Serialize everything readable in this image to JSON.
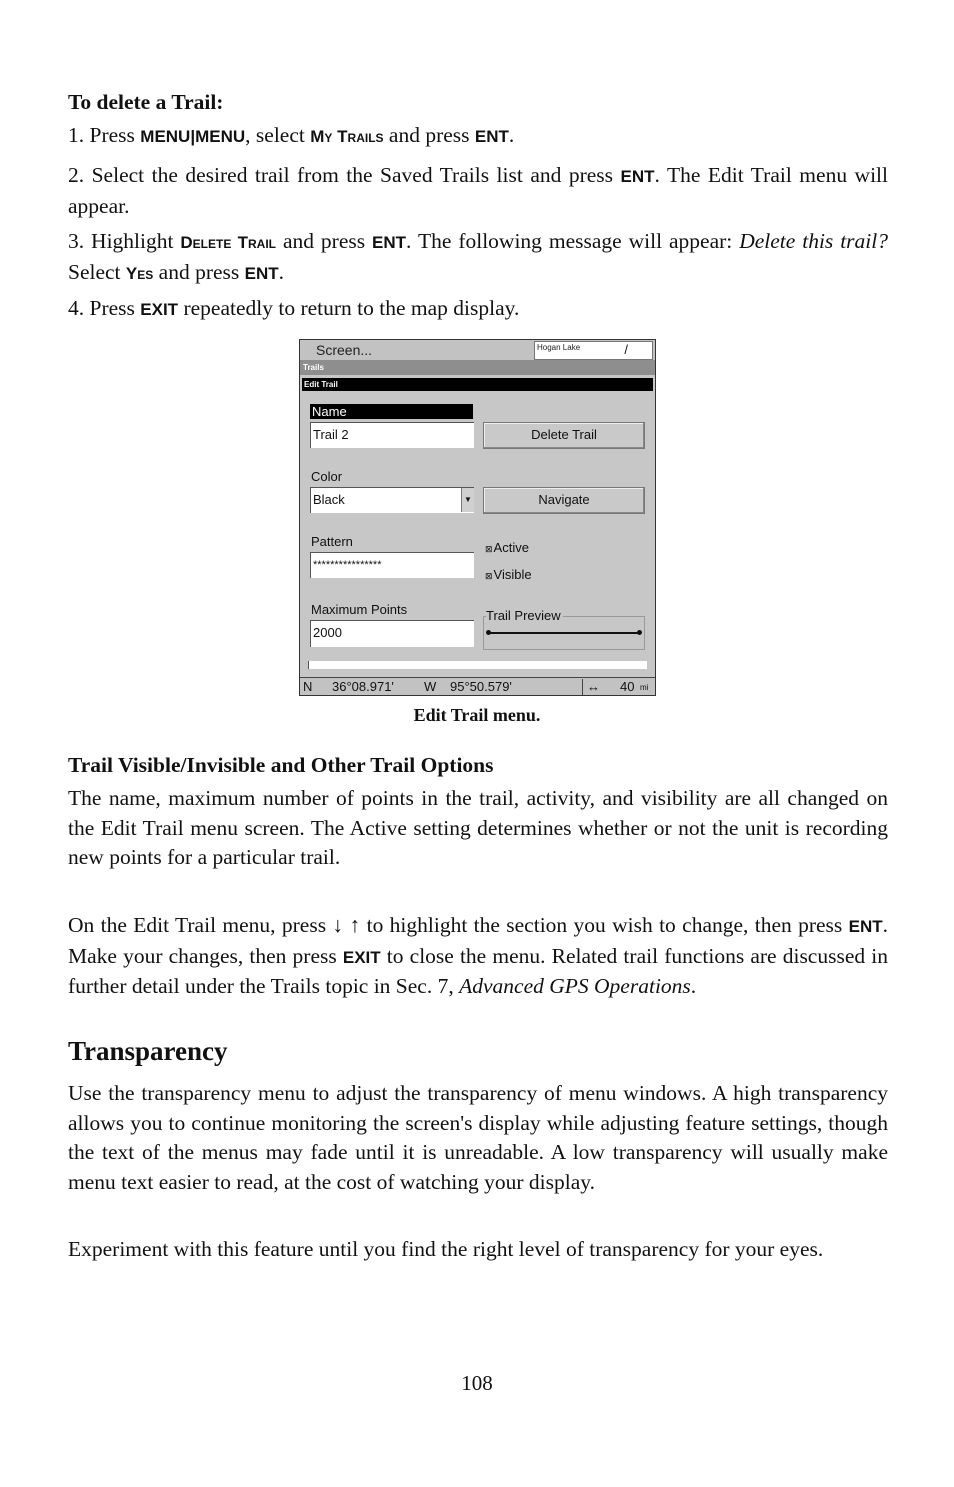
{
  "delete_trail": {
    "heading": "To delete a Trail:",
    "step1": {
      "pre": "1. Press ",
      "key1": "MENU",
      "sep": "|",
      "key2": "MENU",
      "mid": ", select ",
      "menu": "My Trails",
      "mid2": " and press ",
      "key3": "ENT",
      "end": "."
    },
    "step2": {
      "pre": "2. Select the desired trail from the Saved Trails list and press ",
      "key": "ENT",
      "end": ". The Edit Trail menu will appear."
    },
    "step3": {
      "pre": "3. Highlight ",
      "menu": "Delete Trail",
      "mid": " and press ",
      "key1": "ENT",
      "mid2": ". The following message will appear: ",
      "italic": "Delete this trail?",
      "mid3": " Select ",
      "menu2": "Yes",
      "mid4": " and press ",
      "key2": "ENT",
      "end": "."
    },
    "step4": {
      "pre": "4. Press ",
      "key": "EXIT",
      "end": " repeatedly to return to the map display."
    }
  },
  "screen": {
    "top_label": "Screen...",
    "map_label": "Hogan Lake",
    "trails_bar": "Trails",
    "edit_bar": "Edit Trail",
    "name_label": "Name",
    "name_value": "Trail 2",
    "delete_button": "Delete Trail",
    "color_label": "Color",
    "color_value": "Black",
    "navigate_button": "Navigate",
    "pattern_label": "Pattern",
    "pattern_value": "****************",
    "active_label": "Active",
    "active_checked": true,
    "visible_label": "Visible",
    "visible_checked": true,
    "max_points_label": "Maximum Points",
    "max_points_value": "2000",
    "preview_label": "Trail Preview",
    "status": {
      "lat_hem": "N",
      "lat": "36°08.971'",
      "lon_hem": "W",
      "lon": "95°50.579'",
      "zoom_icon": "↔",
      "zoom": "40",
      "unit": "mi"
    }
  },
  "caption": "Edit Trail menu.",
  "options": {
    "heading": "Trail Visible/Invisible and Other Trail Options",
    "para1": "The name, maximum number of points in the trail, activity, and visibility are all changed on the Edit Trail menu screen. The Active setting determines whether or not the unit is recording new points for a particular trail.",
    "para2": {
      "pre": "On the Edit Trail menu, press ",
      "arrows": "↓ ↑",
      "mid": " to highlight the section you wish to change, then press ",
      "key1": "ENT",
      "mid2": ". Make your changes, then press ",
      "key2": "EXIT",
      "mid3": " to close the menu. Related trail functions are discussed in further detail under the Trails topic in Sec. 7, ",
      "italic": "Advanced GPS Operations",
      "end": "."
    }
  },
  "transparency": {
    "heading": "Transparency",
    "para1": "Use the transparency menu to adjust the transparency of menu windows. A high transparency allows you to continue monitoring the screen's display while adjusting feature settings, though the text of the menus may fade until it is unreadable. A low transparency will usually make menu text easier to read, at the cost of watching your display.",
    "para2": "Experiment with this feature until you find the right level of transparency for your eyes."
  },
  "page_number": "108"
}
